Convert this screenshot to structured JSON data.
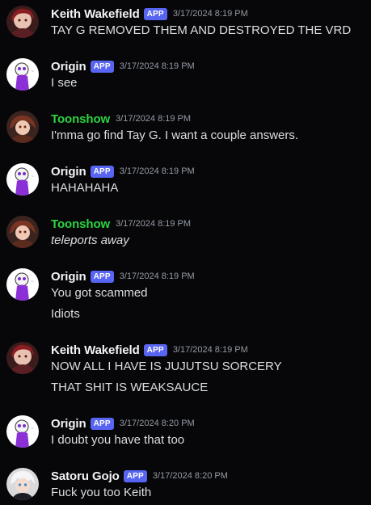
{
  "messages": [
    {
      "author": "Keith Wakefield",
      "badge": "APP",
      "timestamp": "3/17/2024 8:19 PM",
      "lines": [
        "TAY G REMOVED THEM AND DESTROYED THE VRD"
      ]
    },
    {
      "author": "Origin",
      "badge": "APP",
      "timestamp": "3/17/2024 8:19 PM",
      "lines": [
        "I see"
      ]
    },
    {
      "author": "Toonshow",
      "timestamp": "3/17/2024 8:19 PM",
      "lines": [
        "I'mma go find Tay G.  I want a couple answers."
      ]
    },
    {
      "author": "Origin",
      "badge": "APP",
      "timestamp": "3/17/2024 8:19 PM",
      "lines": [
        "HAHAHAHA"
      ]
    },
    {
      "author": "Toonshow",
      "timestamp": "3/17/2024 8:19 PM",
      "lines": [
        "teleports away"
      ]
    },
    {
      "author": "Origin",
      "badge": "APP",
      "timestamp": "3/17/2024 8:19 PM",
      "lines": [
        "You got scammed",
        "Idiots"
      ]
    },
    {
      "author": "Keith Wakefield",
      "badge": "APP",
      "timestamp": "3/17/2024 8:19 PM",
      "lines": [
        "NOW ALL I HAVE IS JUJUTSU SORCERY",
        "THAT SHIT IS WEAKSAUCE"
      ]
    },
    {
      "author": "Origin",
      "badge": "APP",
      "timestamp": "3/17/2024 8:20 PM",
      "lines": [
        "I doubt you have that too"
      ]
    },
    {
      "author": "Satoru Gojo",
      "badge": "APP",
      "timestamp": "3/17/2024 8:20 PM",
      "lines": [
        "Fuck you too Keith"
      ]
    }
  ],
  "colors": {
    "background": "#070709",
    "username": "#f2f3f5",
    "toonshow_username": "#2bd43f",
    "badge": "#5865f2",
    "timestamp": "#949ba4",
    "message_text": "#dbdee1"
  }
}
